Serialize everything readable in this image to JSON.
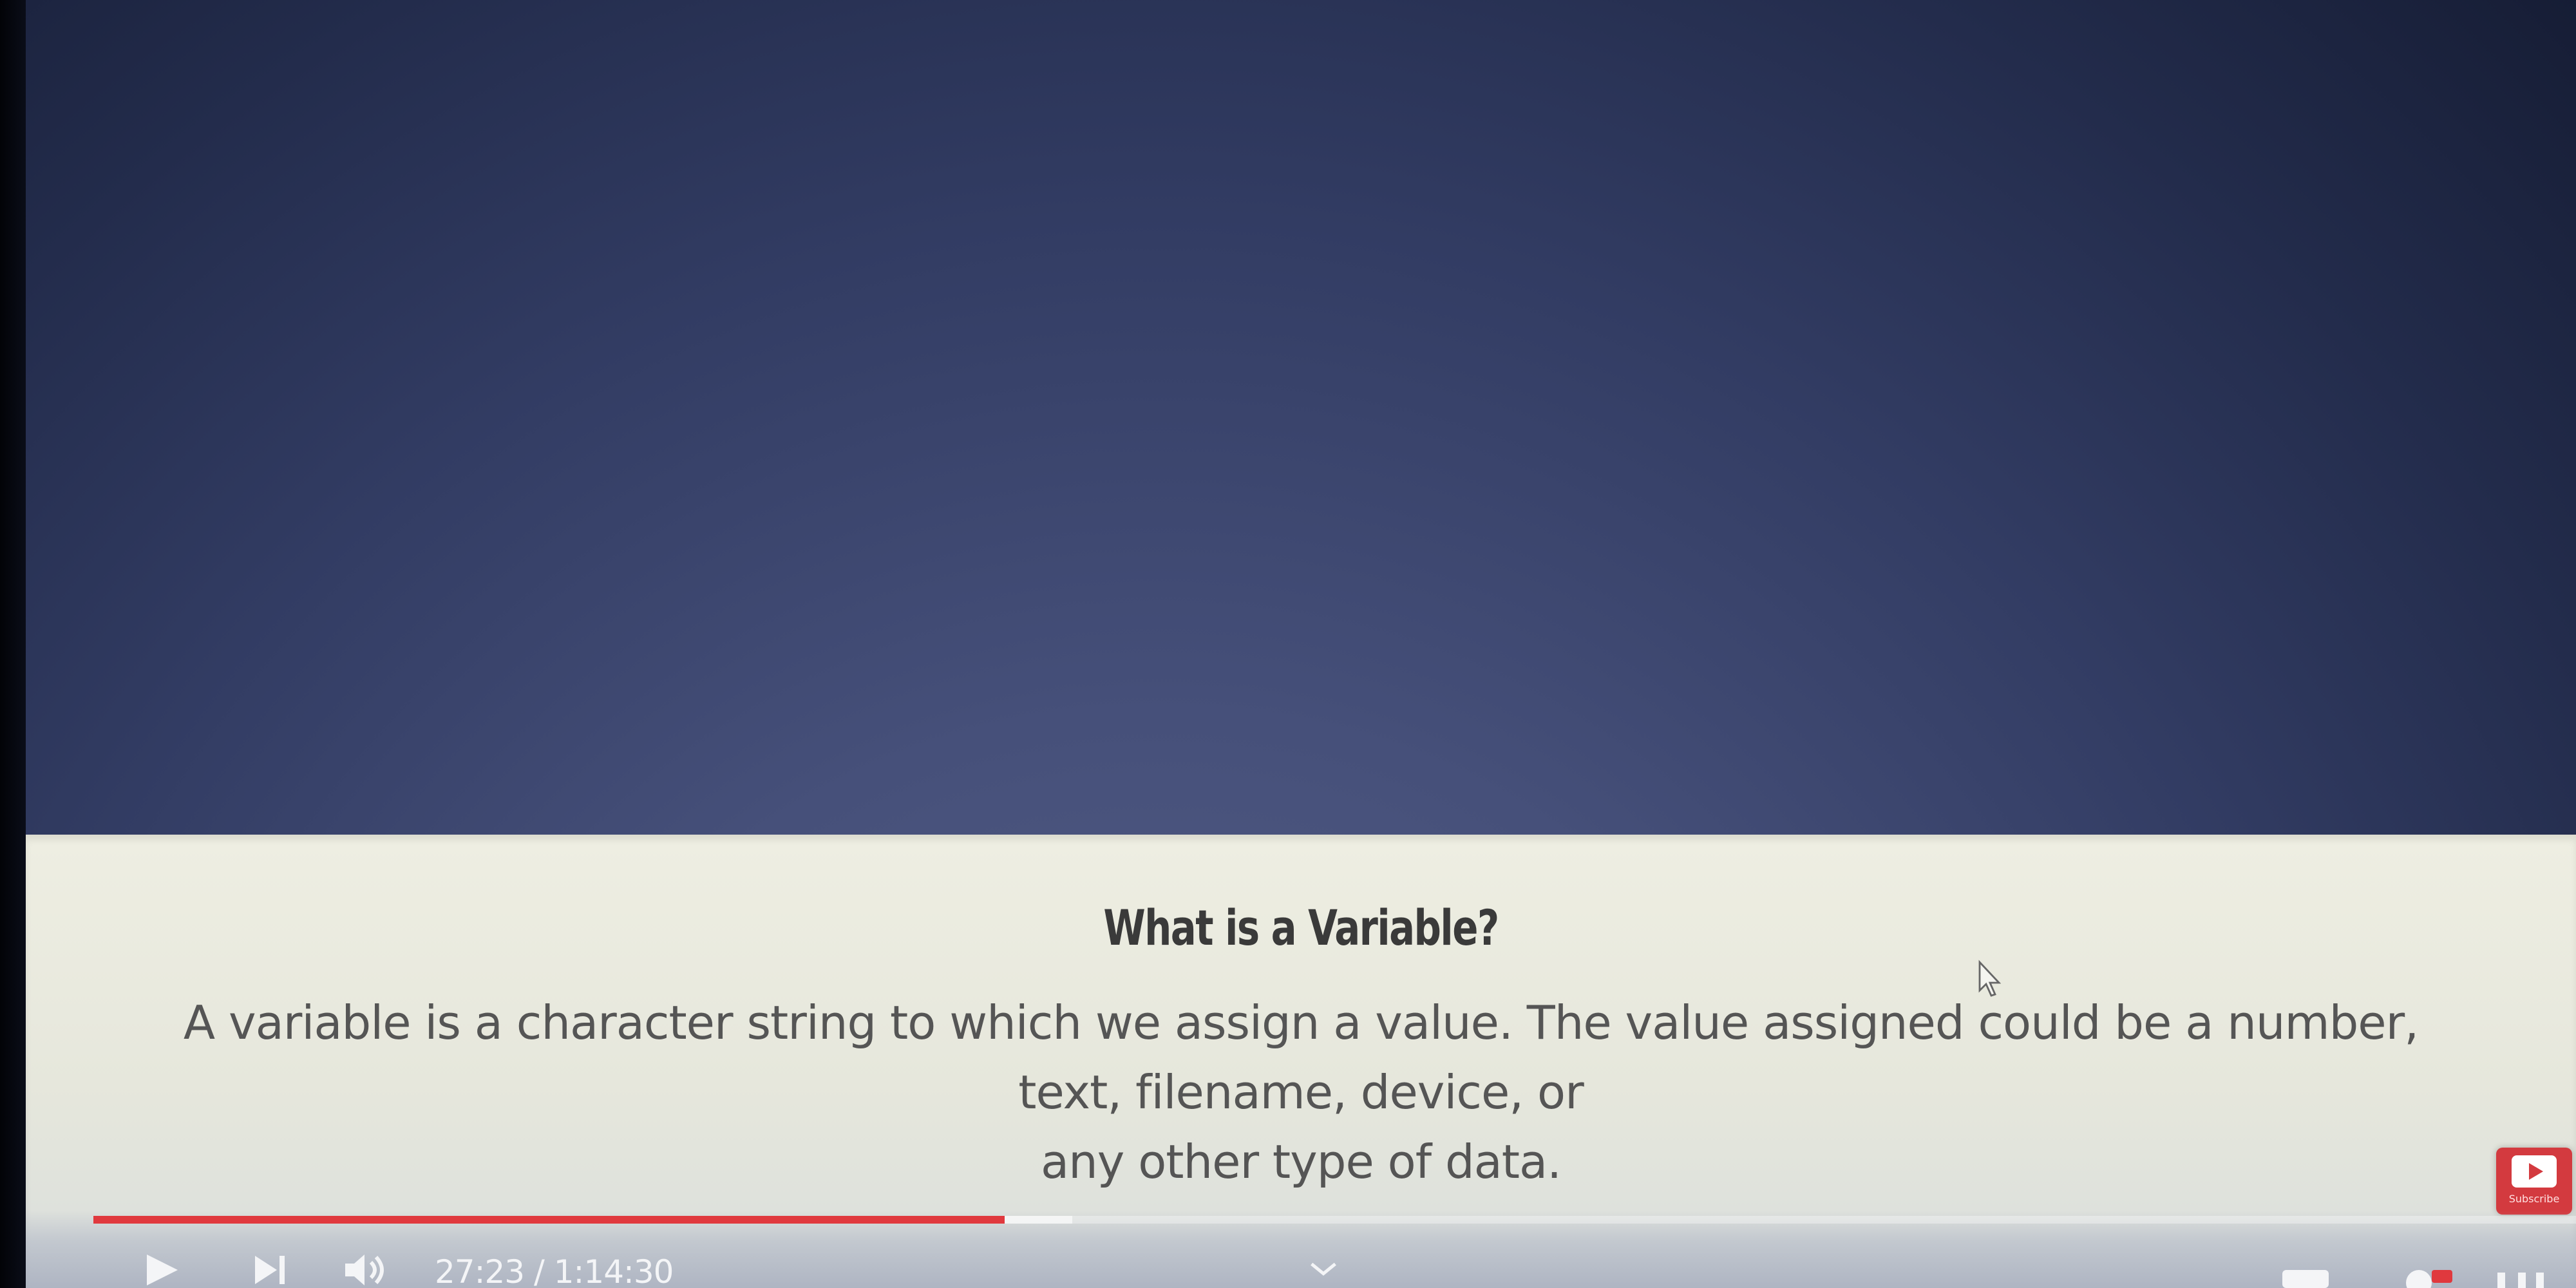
{
  "slide": {
    "title": "What is a Variable?",
    "body_line1": "A variable is a character string to which we assign a value. The value assigned could be a number, text, filename, device, or",
    "body_line2": "any other type of data."
  },
  "player": {
    "current_time": "27:23",
    "duration": "1:14:30",
    "time_separator": " / ",
    "progress_fraction": 0.367,
    "accent_color": "#e0393e",
    "icons": {
      "play": "play-icon",
      "next": "next-icon",
      "volume": "volume-icon",
      "chevron": "chevron-down-icon",
      "subtitles": "subtitles-icon",
      "settings": "settings-icon",
      "theater": "theater-icon"
    }
  },
  "subscribe": {
    "label": "Subscribe",
    "color": "#d33a3f"
  }
}
